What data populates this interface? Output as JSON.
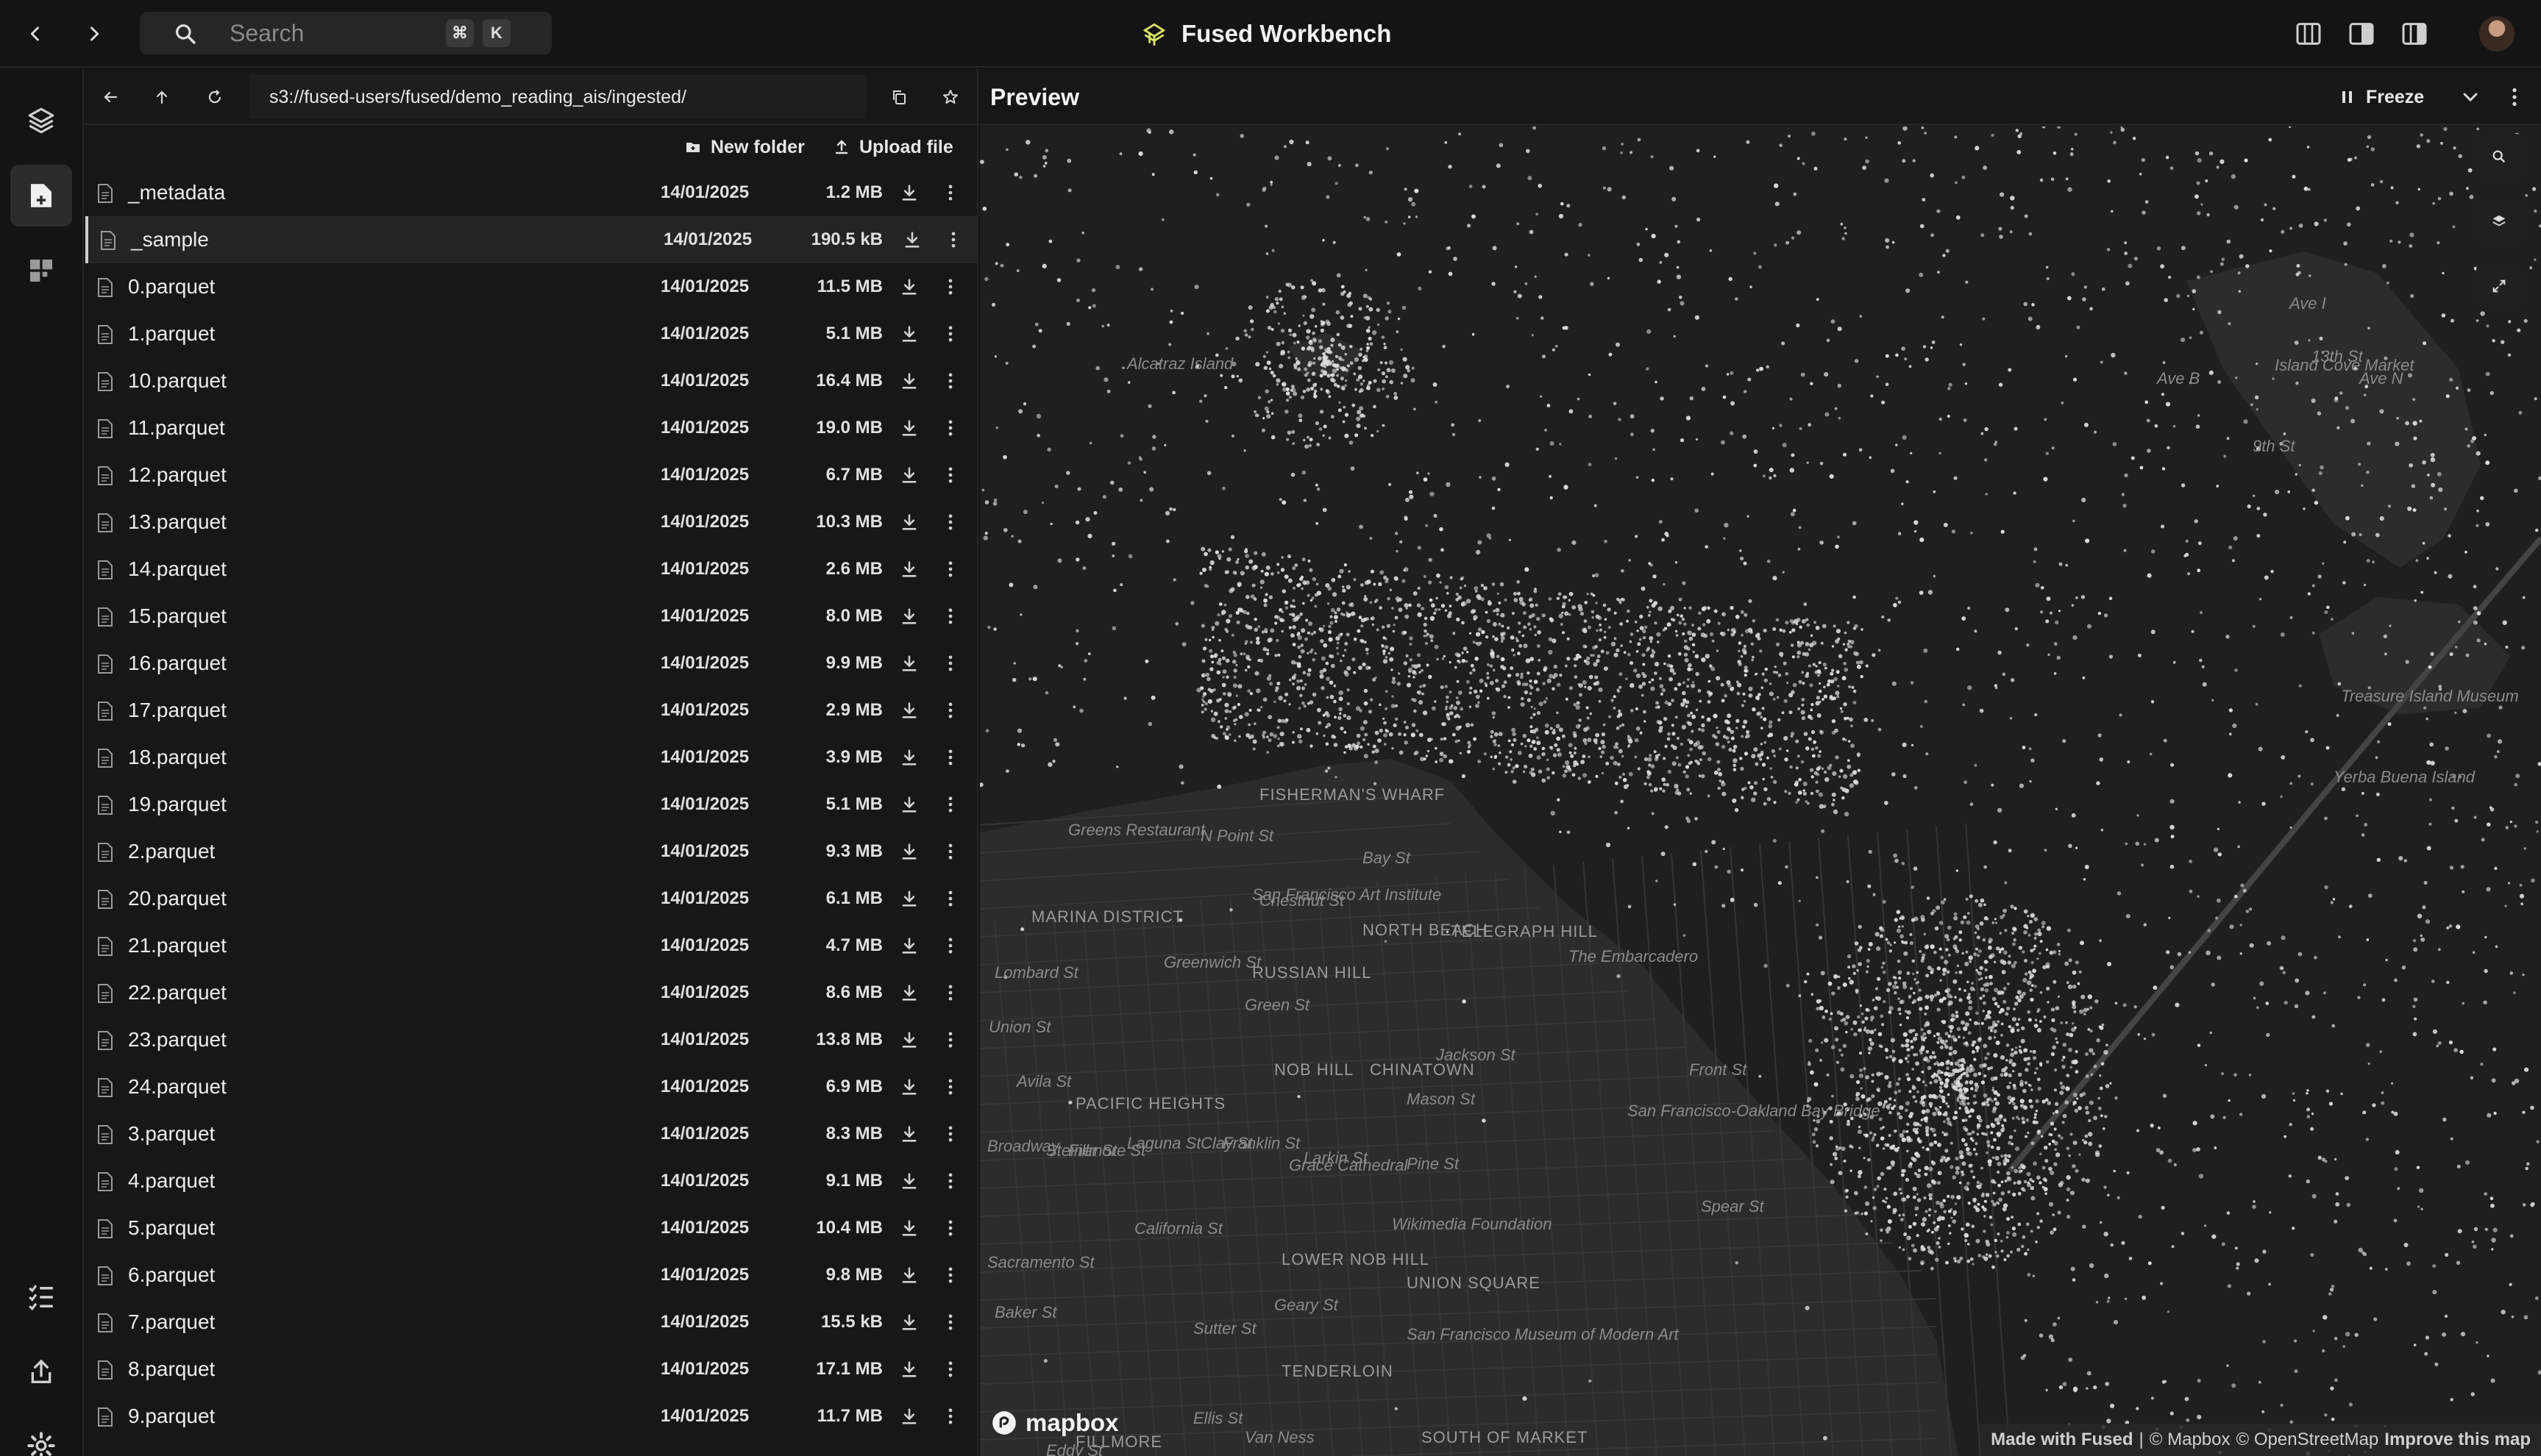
{
  "app": {
    "title": "Fused Workbench"
  },
  "search": {
    "placeholder": "Search",
    "shortcut_mod": "⌘",
    "shortcut_key": "K"
  },
  "file_browser": {
    "path": "s3://fused-users/fused/demo_reading_ais/ingested/",
    "new_folder_label": "New folder",
    "upload_label": "Upload file",
    "files": [
      {
        "name": "_metadata",
        "date": "14/01/2025",
        "size": "1.2 MB",
        "selected": false
      },
      {
        "name": "_sample",
        "date": "14/01/2025",
        "size": "190.5 kB",
        "selected": true
      },
      {
        "name": "0.parquet",
        "date": "14/01/2025",
        "size": "11.5 MB",
        "selected": false
      },
      {
        "name": "1.parquet",
        "date": "14/01/2025",
        "size": "5.1 MB",
        "selected": false
      },
      {
        "name": "10.parquet",
        "date": "14/01/2025",
        "size": "16.4 MB",
        "selected": false
      },
      {
        "name": "11.parquet",
        "date": "14/01/2025",
        "size": "19.0 MB",
        "selected": false
      },
      {
        "name": "12.parquet",
        "date": "14/01/2025",
        "size": "6.7 MB",
        "selected": false
      },
      {
        "name": "13.parquet",
        "date": "14/01/2025",
        "size": "10.3 MB",
        "selected": false
      },
      {
        "name": "14.parquet",
        "date": "14/01/2025",
        "size": "2.6 MB",
        "selected": false
      },
      {
        "name": "15.parquet",
        "date": "14/01/2025",
        "size": "8.0 MB",
        "selected": false
      },
      {
        "name": "16.parquet",
        "date": "14/01/2025",
        "size": "9.9 MB",
        "selected": false
      },
      {
        "name": "17.parquet",
        "date": "14/01/2025",
        "size": "2.9 MB",
        "selected": false
      },
      {
        "name": "18.parquet",
        "date": "14/01/2025",
        "size": "3.9 MB",
        "selected": false
      },
      {
        "name": "19.parquet",
        "date": "14/01/2025",
        "size": "5.1 MB",
        "selected": false
      },
      {
        "name": "2.parquet",
        "date": "14/01/2025",
        "size": "9.3 MB",
        "selected": false
      },
      {
        "name": "20.parquet",
        "date": "14/01/2025",
        "size": "6.1 MB",
        "selected": false
      },
      {
        "name": "21.parquet",
        "date": "14/01/2025",
        "size": "4.7 MB",
        "selected": false
      },
      {
        "name": "22.parquet",
        "date": "14/01/2025",
        "size": "8.6 MB",
        "selected": false
      },
      {
        "name": "23.parquet",
        "date": "14/01/2025",
        "size": "13.8 MB",
        "selected": false
      },
      {
        "name": "24.parquet",
        "date": "14/01/2025",
        "size": "6.9 MB",
        "selected": false
      },
      {
        "name": "3.parquet",
        "date": "14/01/2025",
        "size": "8.3 MB",
        "selected": false
      },
      {
        "name": "4.parquet",
        "date": "14/01/2025",
        "size": "9.1 MB",
        "selected": false
      },
      {
        "name": "5.parquet",
        "date": "14/01/2025",
        "size": "10.4 MB",
        "selected": false
      },
      {
        "name": "6.parquet",
        "date": "14/01/2025",
        "size": "9.8 MB",
        "selected": false
      },
      {
        "name": "7.parquet",
        "date": "14/01/2025",
        "size": "15.5 kB",
        "selected": false
      },
      {
        "name": "8.parquet",
        "date": "14/01/2025",
        "size": "17.1 MB",
        "selected": false
      },
      {
        "name": "9.parquet",
        "date": "14/01/2025",
        "size": "11.7 MB",
        "selected": false
      }
    ]
  },
  "preview": {
    "title": "Preview",
    "freeze_label": "Freeze",
    "map_labels": [
      "Alcatraz Island",
      "Island Cove Market",
      "Treasure Island Museum",
      "Yerba Buena Island",
      "FISHERMAN'S WHARF",
      "Greens Restaurant",
      "N Point St",
      "Bay St",
      "Chestnut St",
      "MARINA DISTRICT",
      "San Francisco Art Institute",
      "NORTH BEACH",
      "TELEGRAPH HILL",
      "RUSSIAN HILL",
      "Greenwich St",
      "Lombard St",
      "Green St",
      "Union St",
      "NOB HILL",
      "CHINATOWN",
      "Jackson St",
      "PACIFIC HEIGHTS",
      "Broadway",
      "Clay St",
      "Grace Cathedral",
      "Pine St",
      "Wikimedia Foundation",
      "California St",
      "LOWER NOB HILL",
      "UNION SQUARE",
      "Geary St",
      "Sutter St",
      "San Francisco Museum of Modern Art",
      "TENDERLOIN",
      "FILLMORE",
      "Ellis St",
      "SOUTH OF MARKET",
      "The Embarcadero",
      "San Francisco-Oakland Bay Bridge",
      "Spear St",
      "Front St",
      "Mason St",
      "Larkin St",
      "Franklin St",
      "Laguna St",
      "Fillmore St",
      "Steiner St",
      "Baker St",
      "Sacramento St",
      "Avila St",
      "Ave B",
      "Ave I",
      "Ave N",
      "9th St",
      "13th St",
      "Eddy St",
      "Van Ness"
    ],
    "mapbox_label": "mapbox",
    "attribution": {
      "made_with": "Made with Fused",
      "mapbox": "© Mapbox",
      "osm": "© OpenStreetMap",
      "improve": "Improve this map"
    }
  },
  "icons": {
    "back": "chevron-left-icon",
    "forward": "chevron-right-icon",
    "search": "search-icon",
    "logo": "fused-logo-icon",
    "layers": "layers-icon",
    "files": "file-plus-icon",
    "apps": "grid-icon",
    "tasks": "list-check-icon",
    "share": "share-icon",
    "settings": "gear-icon"
  },
  "colors": {
    "background": "#141414",
    "panel": "#171717",
    "map_bg": "#2a2a2a",
    "map_road": "#363636",
    "points": "#dcdcdc"
  }
}
